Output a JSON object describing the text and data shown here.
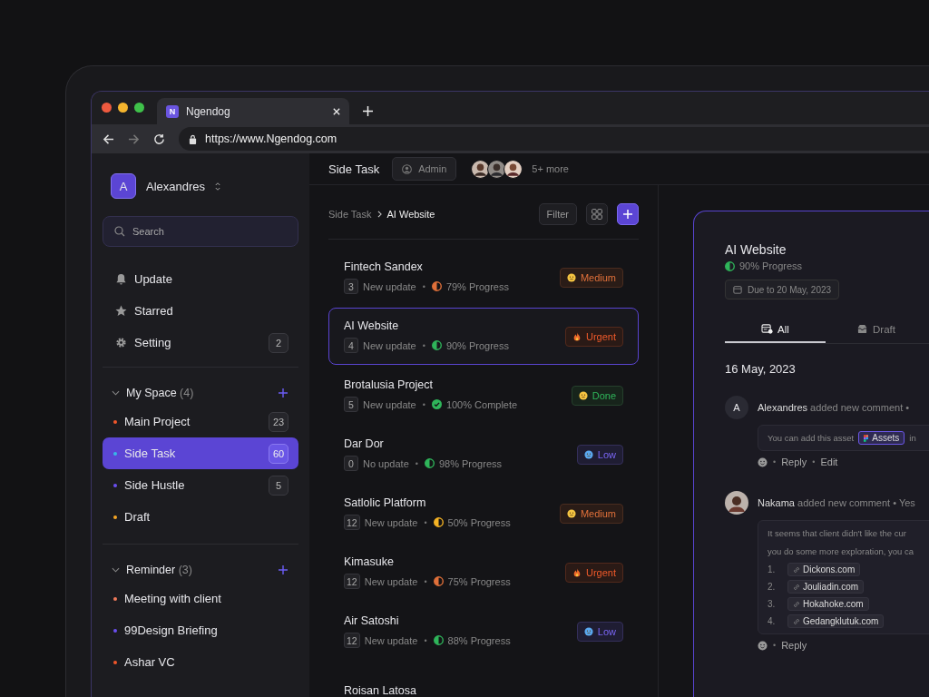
{
  "browser": {
    "tab_title": "Ngendog",
    "tab_logo": "N",
    "url": "https://www.Ngendog.com"
  },
  "sidebar": {
    "user": {
      "initial": "A",
      "name": "Alexandres"
    },
    "search": {
      "placeholder": "Search"
    },
    "nav": [
      {
        "label": "Update",
        "kind": "bell"
      },
      {
        "label": "Starred",
        "kind": "star"
      },
      {
        "label": "Setting",
        "kind": "gear",
        "badge": "2"
      }
    ],
    "sections": [
      {
        "title": "My Space",
        "count": "(4)",
        "expanded": true,
        "items": [
          {
            "label": "Main Project",
            "color": "#f0562a",
            "badge": "23",
            "selected": false
          },
          {
            "label": "Side Task",
            "color": "#38b6e8",
            "badge": "60",
            "selected": true
          },
          {
            "label": "Side Hustle",
            "color": "#6a4ff0",
            "badge": "5",
            "selected": false
          },
          {
            "label": "Draft",
            "color": "#f5a524",
            "selected": false
          }
        ]
      },
      {
        "title": "Reminder",
        "count": "(3)",
        "expanded": true,
        "items": [
          {
            "label": "Meeting with client",
            "color": "#f07a5a",
            "selected": false
          },
          {
            "label": "99Design Briefing",
            "color": "#6a4ff0",
            "selected": false
          },
          {
            "label": "Ashar VC",
            "color": "#f0562a",
            "selected": false
          }
        ]
      }
    ]
  },
  "header": {
    "title": "Side Task",
    "role": "Admin",
    "members": [
      {
        "kind": "picture"
      },
      {
        "kind": "picture"
      },
      {
        "kind": "picture"
      }
    ],
    "more": "5+ more"
  },
  "breadcrumb": [
    "Side Task",
    "AI Website"
  ],
  "filter": "Filter",
  "tasks": [
    {
      "name": "Fintech Sandex",
      "count": "3",
      "update": "New update",
      "separator": "•",
      "progress": {
        "label": "79% Progress",
        "kind": "partial",
        "color": "#e0703a"
      },
      "priority": {
        "label": "Medium",
        "kind": "medium"
      },
      "selected": false
    },
    {
      "name": "AI Website",
      "count": "4",
      "update": "New update",
      "separator": "•",
      "progress": {
        "label": "90% Progress",
        "kind": "partial",
        "color": "#2fb55a"
      },
      "priority": {
        "label": "Urgent",
        "kind": "urgent"
      },
      "selected": true
    },
    {
      "name": "Brotalusia Project",
      "count": "5",
      "update": "New update",
      "separator": "•",
      "progress": {
        "label": "100% Complete",
        "kind": "complete",
        "color": "#2fb55a"
      },
      "priority": {
        "label": "Done",
        "kind": "done"
      },
      "selected": false
    },
    {
      "name": "Dar Dor",
      "count": "0",
      "update": "No update",
      "separator": "•",
      "progress": {
        "label": "98% Progress",
        "kind": "partial",
        "color": "#2fb55a"
      },
      "priority": {
        "label": "Low",
        "kind": "low"
      },
      "selected": false
    },
    {
      "name": "Satlolic Platform",
      "count": "12",
      "update": "New update",
      "separator": "•",
      "progress": {
        "label": "50% Progress",
        "kind": "partial",
        "color": "#f5b324"
      },
      "priority": {
        "label": "Medium",
        "kind": "medium"
      },
      "selected": false
    },
    {
      "name": "Kimasuke",
      "count": "12",
      "update": "New update",
      "separator": "•",
      "progress": {
        "label": "75% Progress",
        "kind": "partial",
        "color": "#e0703a"
      },
      "priority": {
        "label": "Urgent",
        "kind": "urgent"
      },
      "selected": false
    },
    {
      "name": "Air Satoshi",
      "count": "12",
      "update": "New update",
      "separator": "•",
      "progress": {
        "label": "88% Progress",
        "kind": "partial",
        "color": "#2fb55a"
      },
      "priority": {
        "label": "Low",
        "kind": "low"
      },
      "selected": false
    },
    {
      "name": "Roisan Latosa"
    }
  ],
  "detail": {
    "title": "AI Website",
    "progress": {
      "label": "90% Progress",
      "kind": "partial",
      "color": "#2fb55a"
    },
    "due": "Due to 20 May, 2023",
    "tabs": [
      {
        "label": "All",
        "kind": "all",
        "selected": true
      },
      {
        "label": "Draft",
        "kind": "draft",
        "selected": false
      }
    ],
    "date": "16 May, 2023",
    "comments": [
      {
        "avatar": {
          "kind": "initial",
          "text": "A"
        },
        "author": "Alexandres",
        "action": "added new comment •",
        "text": "You can add this asset",
        "chip": "Assets",
        "tail": "in",
        "actions": [
          {
            "separator": "•",
            "label": "Reply"
          },
          {
            "separator": "•",
            "label": "Edit"
          }
        ]
      },
      {
        "avatar": {
          "kind": "picture"
        },
        "author": "Nakama",
        "action": "added new comment • Yes",
        "lines": [
          "It seems that client didn't like the cur",
          "you do some more exploration, you ca"
        ],
        "links": [
          {
            "num": "1.",
            "label": "Dickons.com"
          },
          {
            "num": "2.",
            "label": "Jouliadin.com"
          },
          {
            "num": "3.",
            "label": "Hokahoke.com"
          },
          {
            "num": "4.",
            "label": "Gedangklutuk.com"
          }
        ],
        "actions": [
          {
            "separator": "•",
            "label": "Reply"
          }
        ]
      }
    ]
  }
}
